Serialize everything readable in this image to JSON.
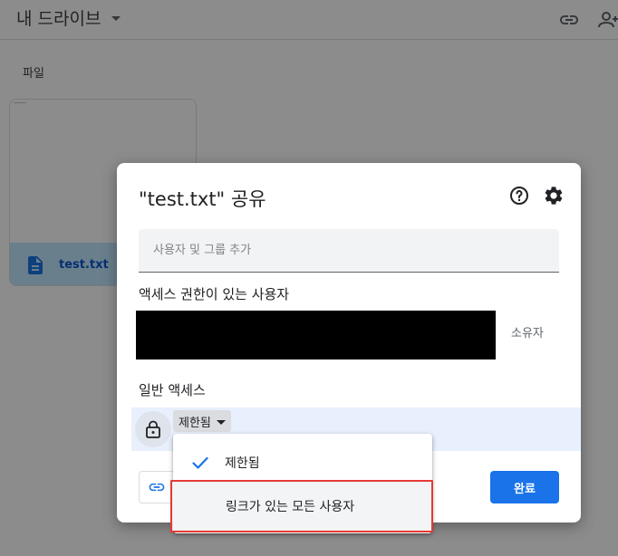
{
  "drive": {
    "title": "내 드라이브",
    "section_label": "파일",
    "file_name": "test.txt"
  },
  "dialog": {
    "title": "\"test.txt\" 공유",
    "add_placeholder": "사용자 및 그룹 추가",
    "access_heading": "액세스 권한이 있는 사용자",
    "owner_label": "소유자",
    "general_heading": "일반 액세스",
    "access_selected": "제한됨",
    "done_label": "완료"
  },
  "dropdown": {
    "items": [
      {
        "label": "제한됨",
        "selected": true
      },
      {
        "label": "링크가 있는 모든 사용자",
        "selected": false
      }
    ]
  },
  "colors": {
    "accent": "#1a73e8",
    "highlight_border": "#e53935",
    "file_footer": "#c2e7ff"
  }
}
